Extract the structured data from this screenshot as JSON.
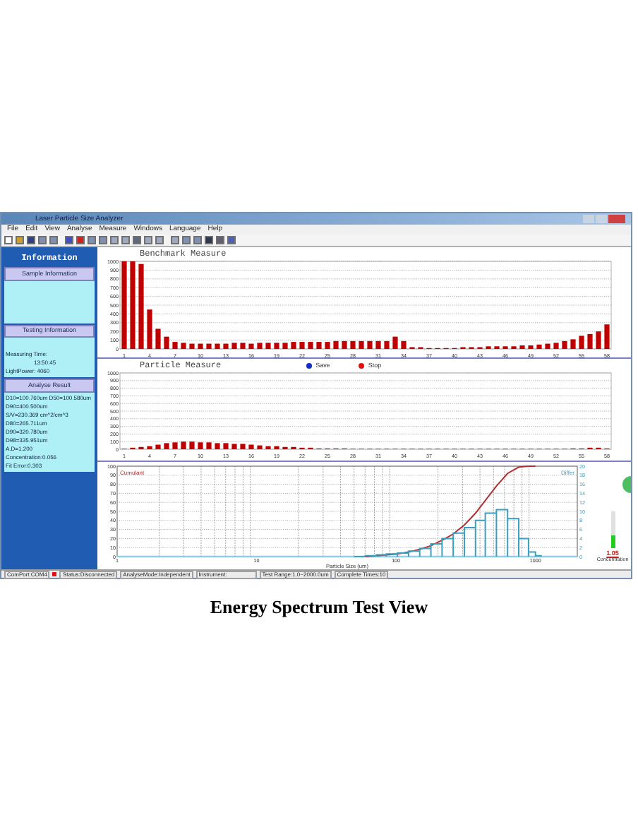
{
  "window": {
    "title": "Laser Particle Size Analyzer"
  },
  "menu": [
    "File",
    "Edit",
    "View",
    "Analyse",
    "Measure",
    "Windows",
    "Language",
    "Help"
  ],
  "info_panel": {
    "title": "Information",
    "sections": [
      {
        "title": "Sample Information"
      },
      {
        "title": "Testing Information",
        "lines": [
          "Measuring Time:",
          "13:50:45",
          "LightPower:  4060"
        ]
      },
      {
        "title": "Analyse Result",
        "lines": [
          "D10=100.760um D50=100.580um",
          "D90=400.500um",
          "S/V=230.369 cm^2/cm^3",
          "D80=265.711um",
          "D90=320.780um",
          "D98=335.951um",
          "A.D=1.200",
          "Concentration:0.056",
          "Fit Error:0.303"
        ]
      }
    ]
  },
  "benchmark": {
    "chart_data": {
      "type": "bar",
      "title": "Benchmark Measure",
      "grid": true,
      "x": [
        1,
        2,
        3,
        4,
        5,
        6,
        7,
        8,
        9,
        10,
        11,
        12,
        13,
        14,
        15,
        16,
        17,
        18,
        19,
        20,
        21,
        22,
        23,
        24,
        25,
        26,
        27,
        28,
        29,
        30,
        31,
        32,
        33,
        34,
        35,
        36,
        37,
        38,
        39,
        40,
        41,
        42,
        43,
        44,
        45,
        46,
        47,
        48,
        49,
        50,
        51,
        52,
        53,
        54,
        55,
        56,
        57,
        58
      ],
      "values": [
        1000,
        1000,
        970,
        450,
        230,
        140,
        80,
        70,
        60,
        60,
        60,
        60,
        60,
        70,
        70,
        60,
        70,
        70,
        70,
        70,
        80,
        80,
        80,
        80,
        80,
        90,
        90,
        90,
        90,
        90,
        90,
        90,
        140,
        90,
        20,
        20,
        10,
        10,
        10,
        10,
        20,
        20,
        20,
        30,
        30,
        30,
        30,
        40,
        40,
        50,
        60,
        70,
        90,
        110,
        150,
        170,
        200,
        280
      ],
      "xlim": [
        0.5,
        58.5
      ],
      "ylim": [
        0,
        1000
      ],
      "yticks": [
        0,
        100,
        200,
        300,
        400,
        500,
        600,
        700,
        800,
        900,
        1000
      ],
      "xticks": [
        1,
        4,
        7,
        10,
        13,
        16,
        19,
        22,
        25,
        28,
        31,
        34,
        37,
        40,
        43,
        46,
        49,
        52,
        55,
        58
      ]
    }
  },
  "particle": {
    "legend": [
      {
        "label": "Save",
        "color": "#1030c0"
      },
      {
        "label": "Stop",
        "color": "#e01010"
      }
    ],
    "chart_data": {
      "type": "bar",
      "title": "Particle Measure",
      "grid": true,
      "x": [
        1,
        2,
        3,
        4,
        5,
        6,
        7,
        8,
        9,
        10,
        11,
        12,
        13,
        14,
        15,
        16,
        17,
        18,
        19,
        20,
        21,
        22,
        23,
        24,
        25,
        26,
        27,
        28,
        29,
        30,
        31,
        32,
        33,
        34,
        35,
        36,
        37,
        38,
        39,
        40,
        41,
        42,
        43,
        44,
        45,
        46,
        47,
        48,
        49,
        50,
        51,
        52,
        53,
        54,
        55,
        56,
        57,
        58
      ],
      "values": [
        0,
        20,
        30,
        40,
        60,
        80,
        90,
        100,
        100,
        90,
        90,
        80,
        80,
        70,
        70,
        60,
        50,
        40,
        40,
        30,
        30,
        20,
        20,
        10,
        10,
        10,
        10,
        0,
        0,
        0,
        0,
        0,
        0,
        0,
        0,
        0,
        0,
        0,
        0,
        0,
        0,
        0,
        0,
        0,
        0,
        0,
        0,
        0,
        0,
        0,
        0,
        0,
        0,
        10,
        10,
        20,
        20,
        10
      ],
      "xlim": [
        0.5,
        58.5
      ],
      "ylim": [
        0,
        1000
      ],
      "yticks": [
        0,
        100,
        200,
        300,
        400,
        500,
        600,
        700,
        800,
        900,
        1000
      ],
      "xticks": [
        1,
        4,
        7,
        10,
        13,
        16,
        19,
        22,
        25,
        28,
        31,
        34,
        37,
        40,
        43,
        46,
        49,
        52,
        55,
        58
      ]
    }
  },
  "distribution": {
    "xlabel": "Particle Size (um)",
    "series_labels": [
      {
        "label": "Cumulant",
        "color": "#b03030"
      },
      {
        "label": "Differ",
        "color": "#3aa0c0"
      }
    ],
    "x_axis_ticks": [
      "1",
      "10",
      "100",
      "1000"
    ],
    "left_axis_ticks": [
      "100",
      "90",
      "80",
      "70",
      "60",
      "50",
      "40",
      "30",
      "20",
      "10",
      "0"
    ],
    "right_axis_ticks": [
      "20",
      "18",
      "16",
      "14",
      "12",
      "10",
      "8",
      "6",
      "4",
      "2",
      "0"
    ],
    "meter": {
      "level": 0.35,
      "reading": "1.05",
      "label": "Concentration"
    }
  },
  "status_bar": [
    "ComPort:COM4",
    "Status:Disconnected",
    "AnalyseMode:Independent",
    "Instrument:",
    "Test Range:1.0~2000.0um",
    "Complete Times:10"
  ],
  "caption": "Energy Spectrum Test View"
}
